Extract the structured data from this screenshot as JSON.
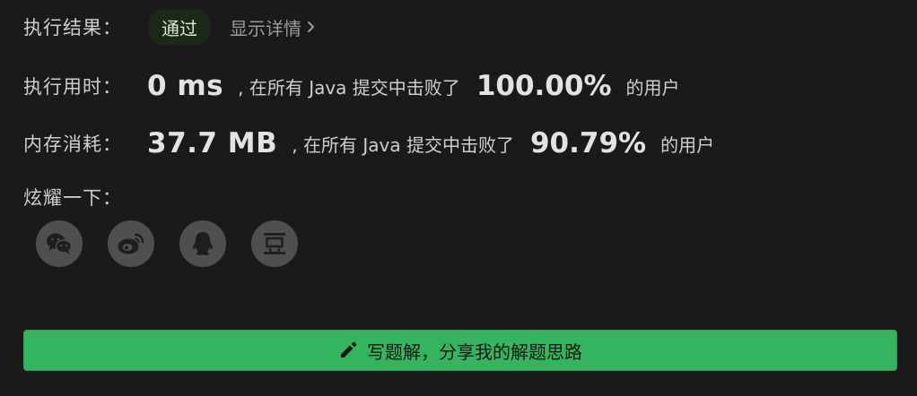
{
  "result": {
    "label": "执行结果：",
    "status": "通过",
    "details_link": "显示详情"
  },
  "runtime": {
    "label": "执行用时：",
    "value": "0 ms",
    "text": ", 在所有 Java 提交中击败了",
    "percent": "100.00%",
    "suffix": "的用户"
  },
  "memory": {
    "label": "内存消耗：",
    "value": "37.7 MB",
    "text": ", 在所有 Java 提交中击败了",
    "percent": "90.79%",
    "suffix": "的用户"
  },
  "share": {
    "label": "炫耀一下：",
    "icons": [
      "wechat-icon",
      "weibo-icon",
      "qq-icon",
      "douban-icon"
    ]
  },
  "cta": {
    "label": "写题解，分享我的解题思路",
    "icon": "pencil-icon"
  },
  "colors": {
    "background": "#1a1a1a",
    "cta_green": "#34b45c",
    "badge_bg": "#1a2a17",
    "icon_bg": "#4f4f4f"
  }
}
